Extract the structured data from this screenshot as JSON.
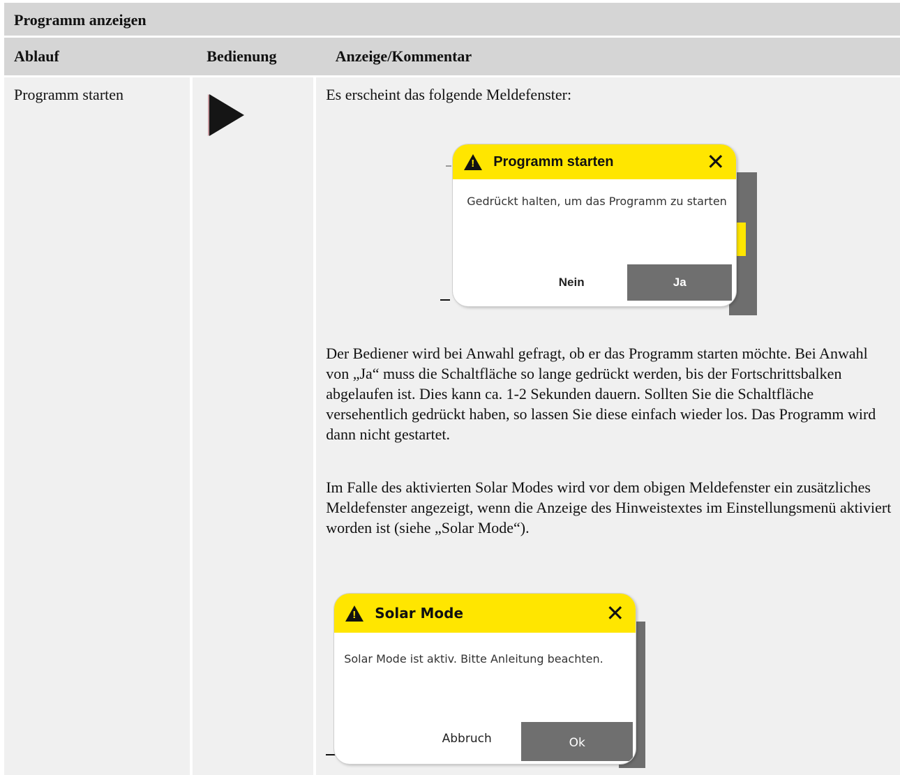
{
  "table": {
    "title": "Programm anzeigen",
    "headers": {
      "col1": "Ablauf",
      "col2": "Bedienung",
      "col3": "Anzeige/Kommentar"
    },
    "row": {
      "step": "Programm starten",
      "control_icon": "play-icon",
      "intro": "Es erscheint das folgende Meldefenster:",
      "paragraph1": "Der Bediener wird bei Anwahl gefragt, ob er das Programm starten möchte. Bei Anwahl von „Ja“ muss die Schaltfläche so lange gedrückt werden, bis der Fortschrittsbalken abgelaufen ist. Dies kann ca. 1-2 Sekunden dauern. Sollten Sie die Schaltfläche versehentlich gedrückt haben, so lassen Sie diese einfach wieder los. Das Programm wird dann nicht gestartet.",
      "paragraph2": "Im Falle des aktivierten Solar Modes wird vor dem obigen Meldefenster ein zusätzliches Meldefenster angezeigt, wenn die Anzeige des Hinweistextes im Einstellungsmenü aktiviert worden ist (siehe „Solar Mode“)."
    }
  },
  "dialog_start": {
    "title": "Programm starten",
    "message": "Gedrückt halten, um das Programm zu starten",
    "no_label": "Nein",
    "yes_label": "Ja",
    "header_color": "#ffe600"
  },
  "dialog_solar": {
    "title": "Solar Mode",
    "message": "Solar Mode ist aktiv. Bitte Anleitung beachten.",
    "no_label": "Abbruch",
    "yes_label": "Ok",
    "header_color": "#ffe600"
  }
}
